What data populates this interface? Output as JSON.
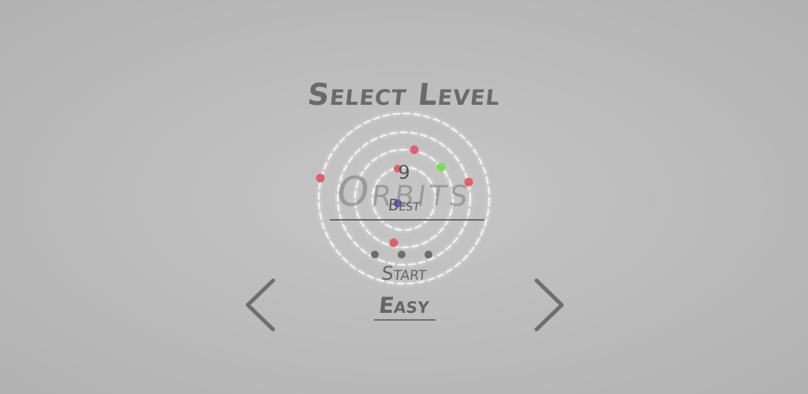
{
  "screen": {
    "title": "Select Level",
    "game_title": "Orbits",
    "best_value": "9",
    "best_label": "Best",
    "start_label": "Start",
    "difficulty_label": "Easy",
    "prev_icon": "chevron-left-icon",
    "next_icon": "chevron-right-icon"
  },
  "colors": {
    "background": "#bdbdbd",
    "text": "#6a6a6a",
    "orbit_ring": "#ffffff",
    "planet_red": "#e0606a",
    "planet_green": "#7ed957",
    "planet_blue": "#4a4ad8"
  }
}
